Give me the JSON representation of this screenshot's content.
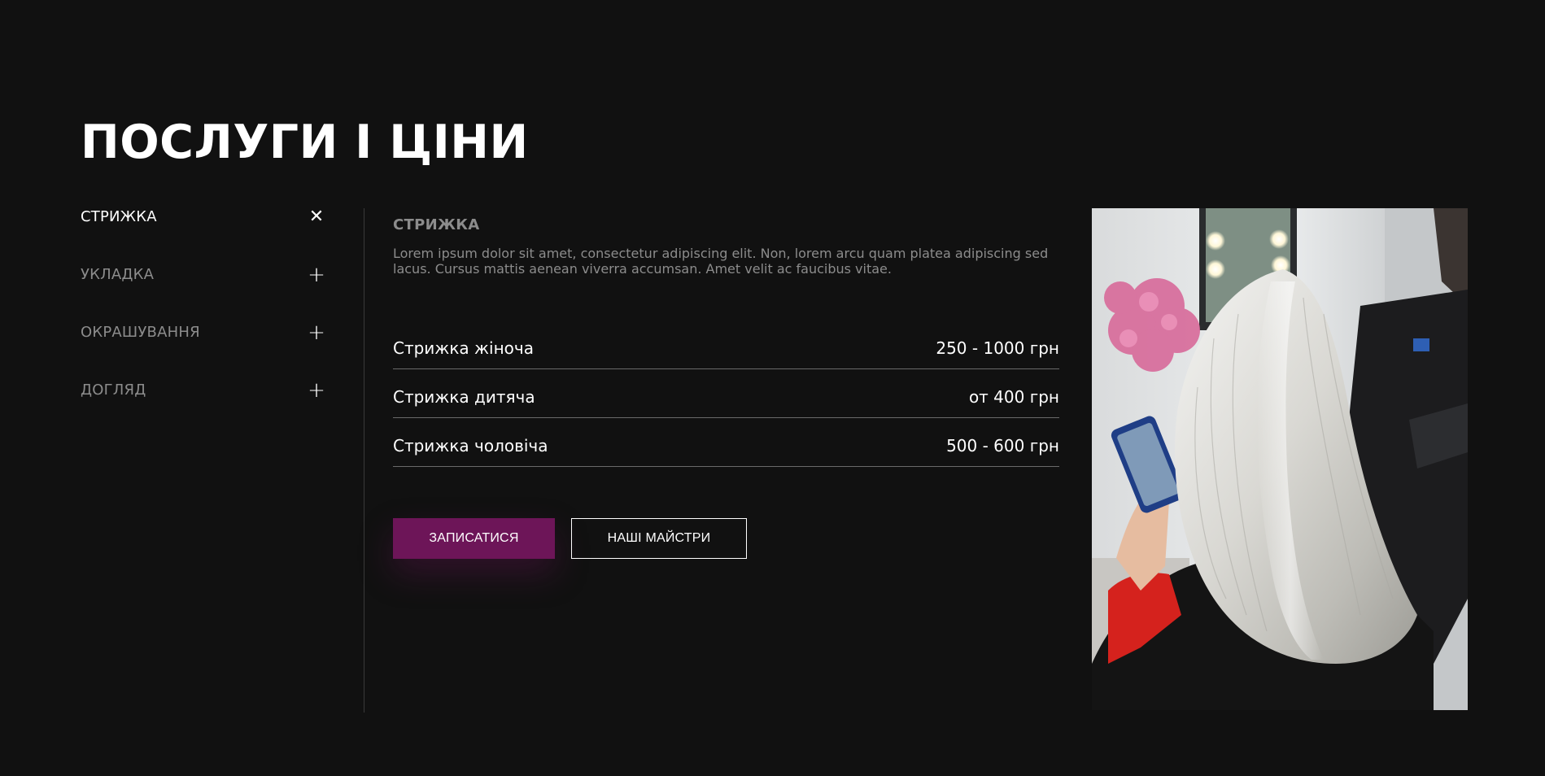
{
  "page": {
    "title": "ПОСЛУГИ І ЦІНИ"
  },
  "sidebar": {
    "items": [
      {
        "label": "СТРИЖКА",
        "toggle": "✕",
        "active": true
      },
      {
        "label": "УКЛАДКА",
        "toggle": "+",
        "active": false
      },
      {
        "label": "ОКРАШУВАННЯ",
        "toggle": "+",
        "active": false
      },
      {
        "label": "ДОГЛЯД",
        "toggle": "+",
        "active": false
      }
    ]
  },
  "content": {
    "title": "СТРИЖКА",
    "description": "Lorem ipsum dolor sit amet, consectetur adipiscing elit. Non, lorem arcu quam platea adipiscing sed lacus. Cursus mattis aenean viverra accumsan. Amet velit ac faucibus vitae.",
    "prices": [
      {
        "name": "Стрижка жіноча",
        "price": "250 - 1000 грн"
      },
      {
        "name": "Стрижка дитяча",
        "price": "от 400 грн"
      },
      {
        "name": "Стрижка чоловіча",
        "price": "500 - 600 грн"
      }
    ]
  },
  "buttons": {
    "book_label": "ЗАПИСАТИСЯ",
    "masters_label": "НАШІ МАЙСТРИ"
  },
  "colors": {
    "background": "#111111",
    "accent": "#6d1558",
    "muted_text": "#8c8c8c"
  }
}
